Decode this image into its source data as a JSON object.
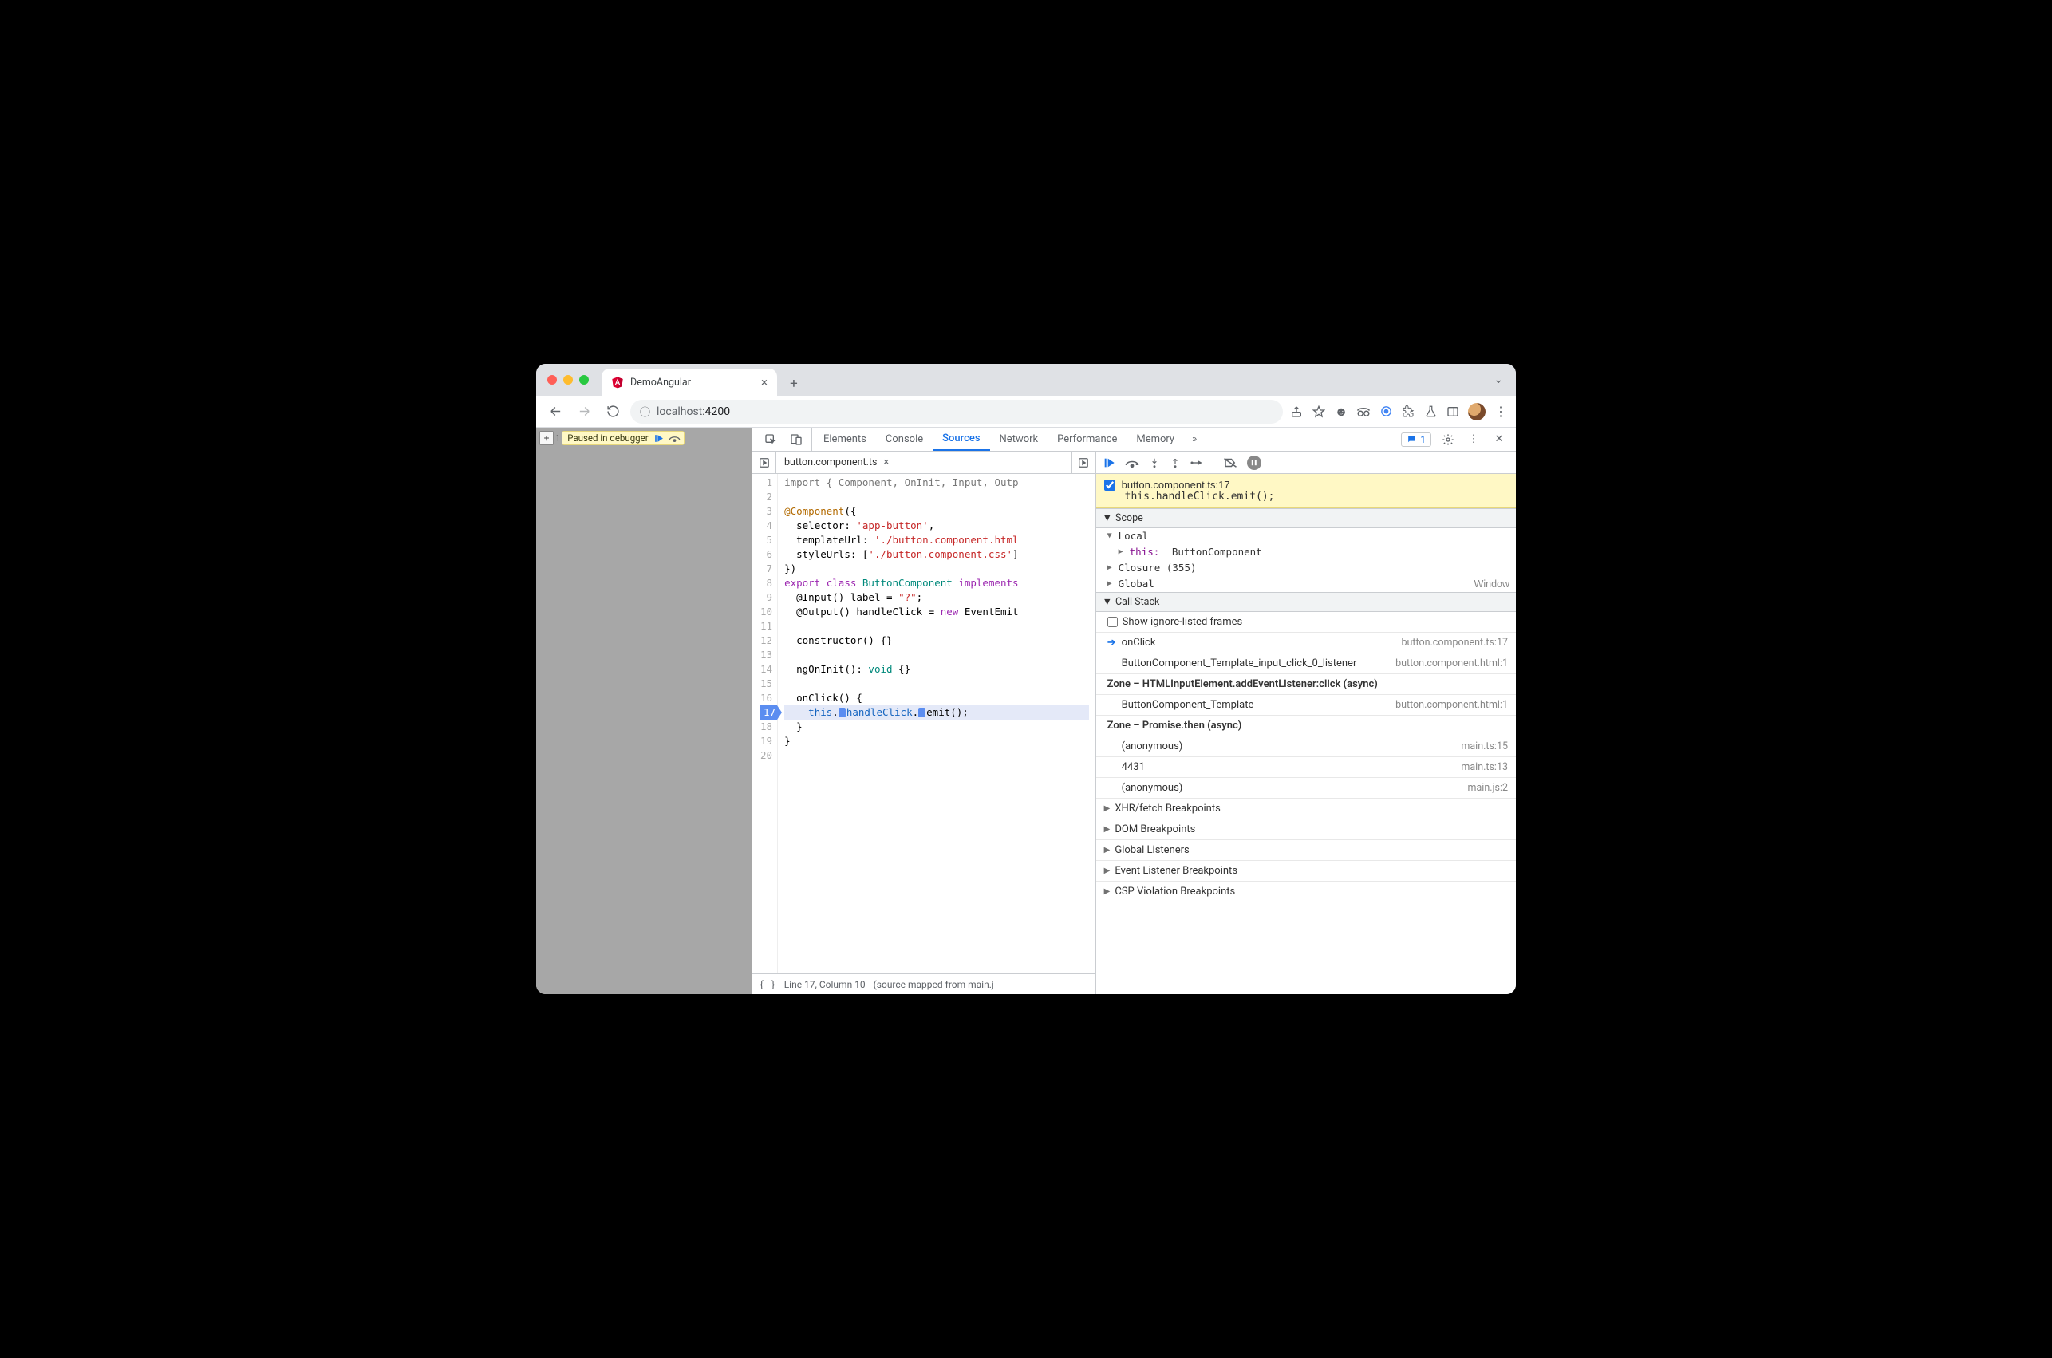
{
  "browser_tab": {
    "title": "DemoAngular"
  },
  "url": {
    "host": "localhost",
    "port": ":4200",
    "info_tooltip": "View site information"
  },
  "page": {
    "paused_label": "Paused in debugger",
    "count": "1"
  },
  "devtools": {
    "tabs": [
      "Elements",
      "Console",
      "Sources",
      "Network",
      "Performance",
      "Memory"
    ],
    "active_tab": 2,
    "more": "»",
    "issues_count": "1"
  },
  "sources": {
    "filename": "button.component.ts",
    "gutter_start": 1,
    "current_line": 17,
    "lines": [
      {
        "n": 1,
        "tokens": [
          {
            "t": "import { Component, OnInit, Input, Outp",
            "c": "cm"
          }
        ]
      },
      {
        "n": 2,
        "tokens": [
          {
            "t": " "
          }
        ]
      },
      {
        "n": 3,
        "tokens": [
          {
            "t": "@Component",
            "c": "k-orange"
          },
          {
            "t": "({"
          }
        ]
      },
      {
        "n": 4,
        "tokens": [
          {
            "t": "  selector: "
          },
          {
            "t": "'app-button'",
            "c": "k-red"
          },
          {
            "t": ","
          }
        ]
      },
      {
        "n": 5,
        "tokens": [
          {
            "t": "  templateUrl: "
          },
          {
            "t": "'./button.component.html",
            "c": "k-red"
          }
        ]
      },
      {
        "n": 6,
        "tokens": [
          {
            "t": "  styleUrls: ["
          },
          {
            "t": "'./button.component.css'",
            "c": "k-red"
          },
          {
            "t": "]"
          }
        ]
      },
      {
        "n": 7,
        "tokens": [
          {
            "t": "})"
          }
        ]
      },
      {
        "n": 8,
        "tokens": [
          {
            "t": "export ",
            "c": "k-purple"
          },
          {
            "t": "class ",
            "c": "k-purple"
          },
          {
            "t": "ButtonComponent",
            "c": "k-teal"
          },
          {
            "t": " implements",
            "c": "k-purple"
          }
        ]
      },
      {
        "n": 9,
        "tokens": [
          {
            "t": "  @Input() label = "
          },
          {
            "t": "\"?\"",
            "c": "k-red"
          },
          {
            "t": ";"
          }
        ]
      },
      {
        "n": 10,
        "tokens": [
          {
            "t": "  @Output() handleClick = "
          },
          {
            "t": "new ",
            "c": "k-purple"
          },
          {
            "t": "EventEmit"
          }
        ]
      },
      {
        "n": 11,
        "tokens": [
          {
            "t": " "
          }
        ]
      },
      {
        "n": 12,
        "tokens": [
          {
            "t": "  constructor() {}"
          }
        ]
      },
      {
        "n": 13,
        "tokens": [
          {
            "t": " "
          }
        ]
      },
      {
        "n": 14,
        "tokens": [
          {
            "t": "  ngOnInit(): "
          },
          {
            "t": "void",
            "c": "k-teal"
          },
          {
            "t": " {}"
          }
        ]
      },
      {
        "n": 15,
        "tokens": [
          {
            "t": " "
          }
        ]
      },
      {
        "n": 16,
        "tokens": [
          {
            "t": "  onClick() {"
          }
        ]
      },
      {
        "n": 17,
        "tokens": [
          {
            "t": "    "
          },
          {
            "t": "this",
            "c": "k-blue"
          },
          {
            "t": "."
          },
          {
            "box": true
          },
          {
            "t": "handleClick",
            "c": "k-blue"
          },
          {
            "t": "."
          },
          {
            "box": true
          },
          {
            "t": "emit();"
          }
        ]
      },
      {
        "n": 18,
        "tokens": [
          {
            "t": "  }"
          }
        ]
      },
      {
        "n": 19,
        "tokens": [
          {
            "t": "}"
          }
        ]
      },
      {
        "n": 20,
        "tokens": [
          {
            "t": " "
          }
        ]
      }
    ],
    "status": {
      "pos": "Line 17, Column 10",
      "mapped_prefix": "(source mapped from ",
      "mapped_link": "main.j"
    }
  },
  "debugger": {
    "breakpoint": {
      "file": "button.component.ts:17",
      "code": "this.handleClick.emit();"
    },
    "scope_label": "Scope",
    "scopes": {
      "local_label": "Local",
      "this_label": "this:",
      "this_value": "ButtonComponent",
      "closure_label": "Closure (355)",
      "global_label": "Global",
      "global_value": "Window"
    },
    "callstack_label": "Call Stack",
    "ignore_label": "Show ignore-listed frames",
    "frames": [
      {
        "type": "current",
        "name": "onClick",
        "loc": "button.component.ts:17"
      },
      {
        "type": "frame",
        "name": "ButtonComponent_Template_input_click_0_listener",
        "loc": "button.component.html:1"
      },
      {
        "type": "zone",
        "name": "Zone – HTMLInputElement.addEventListener:click (async)"
      },
      {
        "type": "frame",
        "name": "ButtonComponent_Template",
        "loc": "button.component.html:1"
      },
      {
        "type": "zone",
        "name": "Zone – Promise.then (async)"
      },
      {
        "type": "frame",
        "name": "(anonymous)",
        "loc": "main.ts:15"
      },
      {
        "type": "frame",
        "name": "4431",
        "loc": "main.ts:13"
      },
      {
        "type": "frame",
        "name": "(anonymous)",
        "loc": "main.js:2"
      }
    ],
    "sections": [
      "XHR/fetch Breakpoints",
      "DOM Breakpoints",
      "Global Listeners",
      "Event Listener Breakpoints",
      "CSP Violation Breakpoints"
    ]
  }
}
